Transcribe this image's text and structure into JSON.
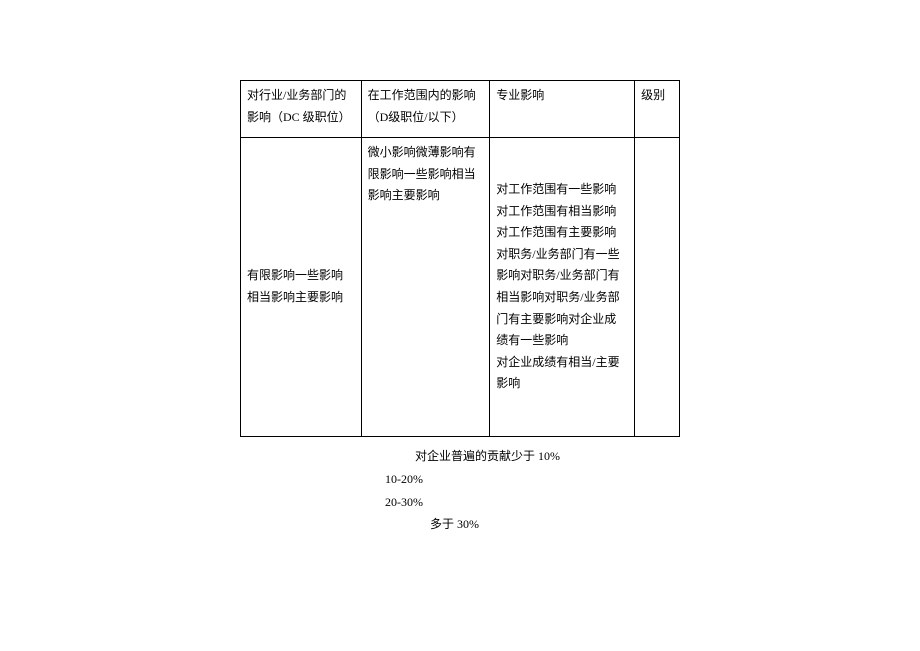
{
  "table": {
    "headers": {
      "col1": "对行业/业务部门的影响（DC 级职位）",
      "col2": "在工作范围内的影响（D级职位/以下）",
      "col3": "专业影响",
      "col4": "级别"
    },
    "body": {
      "col1": "有限影响一些影响相当影响主要影响",
      "col2": "微小影响微薄影响有限影响一些影响相当影响主要影响",
      "col3": "对工作范围有一些影响\n对工作范围有相当影响\n对工作范围有主要影响\n对职务/业务部门有一些影响对职务/业务部门有相当影响对职务/业务部门有主要影响对企业成绩有一些影响\n对企业成绩有相当/主要影响"
    }
  },
  "footer": {
    "line1": "对企业普遍的贡献少于 10%",
    "line2": "10-20%",
    "line3": "20-30%",
    "line4": "多于 30%"
  }
}
